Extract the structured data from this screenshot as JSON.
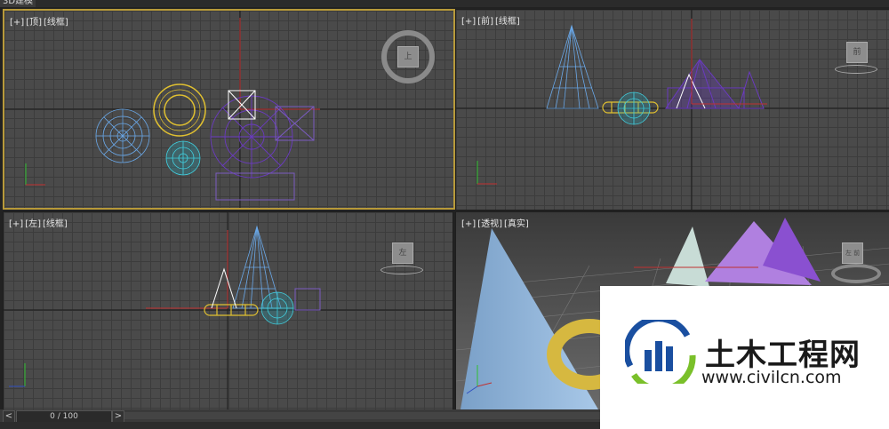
{
  "window": {
    "title": "3D建模"
  },
  "viewports": {
    "top": {
      "plus": "[+]",
      "view": "[顶]",
      "shading": "[线框]",
      "cube_label": "上"
    },
    "front": {
      "plus": "[+]",
      "view": "[前]",
      "shading": "[线框]",
      "cube_label": "前"
    },
    "left": {
      "plus": "[+]",
      "view": "[左]",
      "shading": "[线框]",
      "cube_label": "左"
    },
    "perspective": {
      "plus": "[+]",
      "view": "[透视]",
      "shading": "[真实]",
      "cube_label": "左 前"
    }
  },
  "timeline": {
    "frame_display": "0 / 100",
    "prev_label": "<",
    "next_label": ">"
  },
  "watermark": {
    "name": "土木工程网",
    "url": "www.civilcn.com"
  },
  "colors": {
    "active_border": "#b89a3a",
    "cone": "#6aa8e8",
    "torus": "#e0c030",
    "sphere": "#40d0e0",
    "pyramid": "#8050d0",
    "box": "#7a5bc0"
  }
}
